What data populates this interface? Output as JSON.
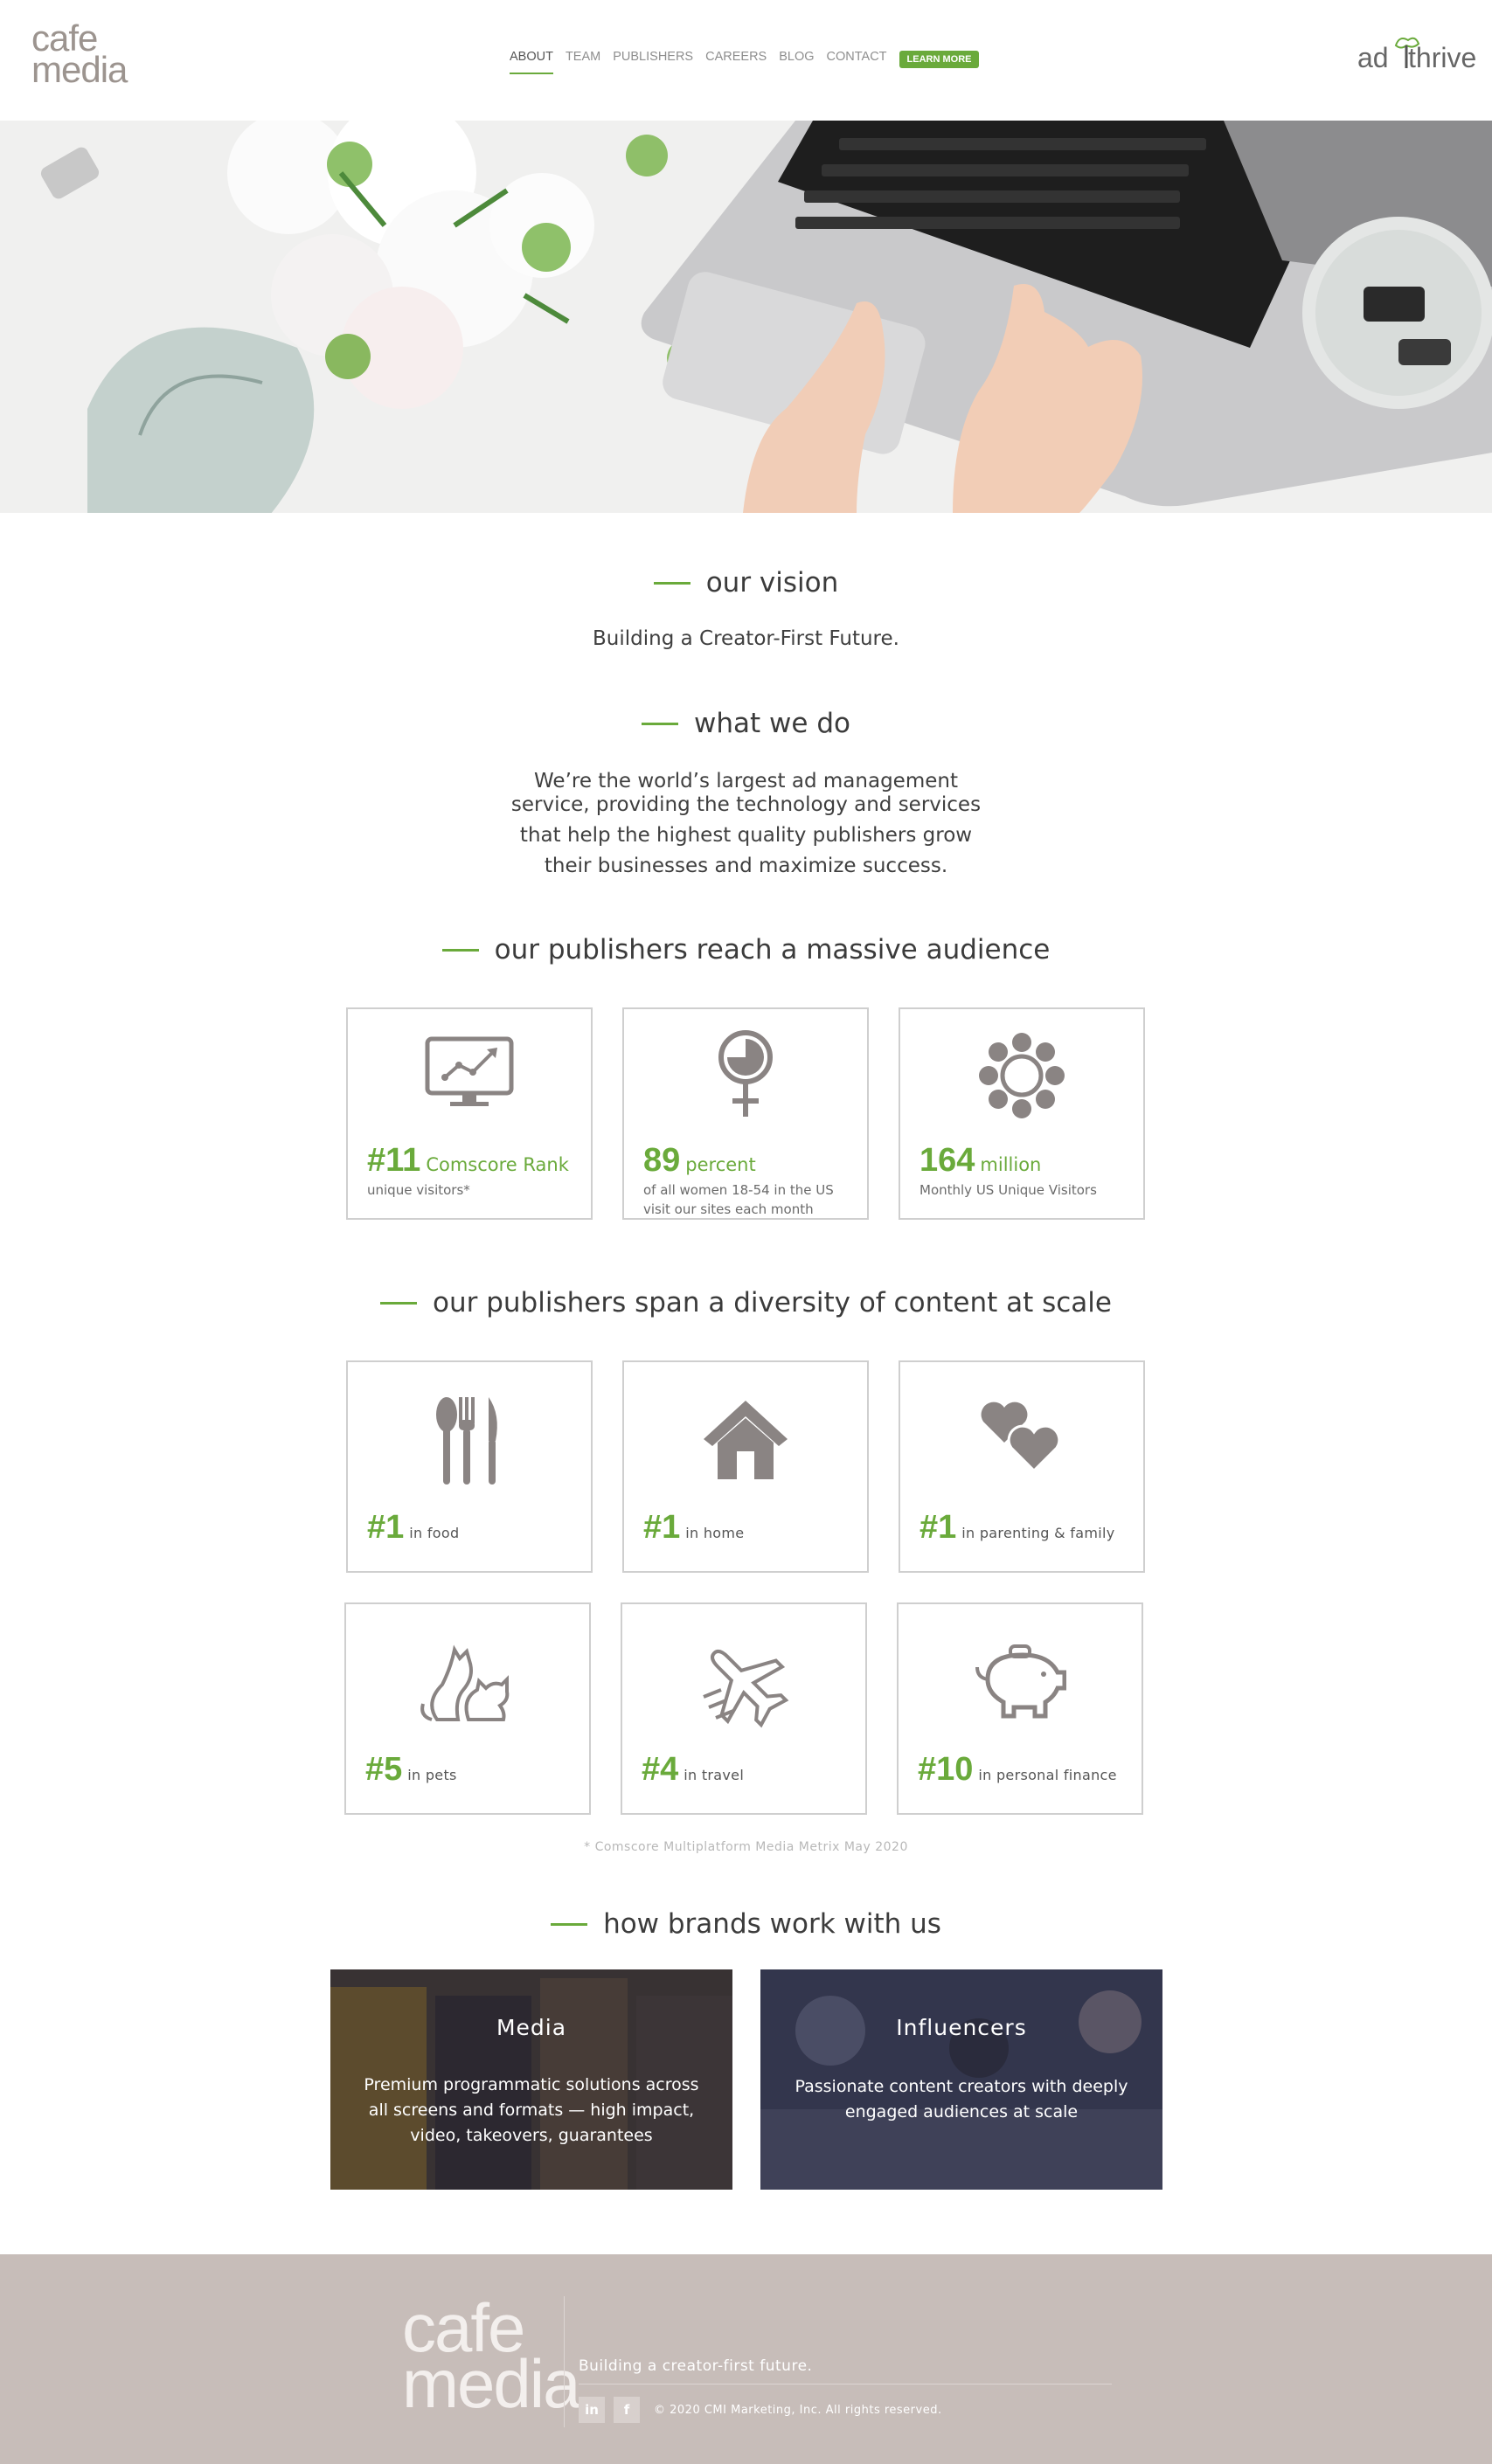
{
  "header": {
    "logo": {
      "line1": "cafe",
      "line2": "media"
    },
    "nav": [
      {
        "label": "ABOUT",
        "active": true
      },
      {
        "label": "TEAM"
      },
      {
        "label": "PUBLISHERS"
      },
      {
        "label": "CAREERS"
      },
      {
        "label": "BLOG"
      },
      {
        "label": "CONTACT"
      }
    ],
    "cta": "LEARN MORE",
    "partner_logo": {
      "line1": "ad",
      "line2": "thrive"
    }
  },
  "vision": {
    "title": "our vision",
    "text": "Building a Creator-First Future."
  },
  "what_we_do": {
    "title": "what we do",
    "lines": [
      "We’re the world’s largest ad management",
      "service, providing the technology and services",
      "that help the highest quality publishers grow",
      "their businesses and maximize success."
    ]
  },
  "audience": {
    "title": "our publishers reach a massive audience",
    "cards": [
      {
        "icon": "monitor-chart-icon",
        "big": "#11",
        "unit": "Comscore Rank",
        "sub": [
          "unique visitors*"
        ]
      },
      {
        "icon": "female-symbol-icon",
        "big": "89",
        "unit": "percent",
        "sub": [
          "of all women 18-54 in the US",
          "visit our sites each month"
        ]
      },
      {
        "icon": "flower-icon",
        "big": "164",
        "unit": "million",
        "sub": [
          "Monthly US Unique Visitors"
        ]
      }
    ]
  },
  "diversity": {
    "title": "our publishers span a diversity of content at scale",
    "cards": [
      {
        "icon": "utensils-icon",
        "big": "#1",
        "label": "in food"
      },
      {
        "icon": "house-icon",
        "big": "#1",
        "label": "in home"
      },
      {
        "icon": "hearts-icon",
        "big": "#1",
        "label": "in parenting & family"
      },
      {
        "icon": "pets-icon",
        "big": "#5",
        "label": "in pets"
      },
      {
        "icon": "airplane-icon",
        "big": "#4",
        "label": "in travel"
      },
      {
        "icon": "piggy-bank-icon",
        "big": "#10",
        "label": "in personal finance"
      }
    ],
    "footnote": "* Comscore Multiplatform Media Metrix May 2020"
  },
  "brands": {
    "title": "how brands work with us",
    "items": [
      {
        "title": "Media",
        "lines": [
          "Premium programmatic solutions across",
          "all screens and formats — high impact,",
          "video, takeovers, guarantees"
        ]
      },
      {
        "title": "Influencers",
        "lines": [
          "Passionate content creators with deeply",
          "engaged audiences at scale"
        ]
      }
    ]
  },
  "footer": {
    "logo": {
      "line1": "cafe",
      "line2": "media"
    },
    "tagline": "Building a creator-first future.",
    "social": [
      "in",
      "f"
    ],
    "copyright": "© 2020 CMI Marketing, Inc. All rights reserved."
  },
  "colors": {
    "accent": "#6aaa3b",
    "icon_gray": "#8a8483",
    "footer_bg": "#c7bdb9"
  }
}
